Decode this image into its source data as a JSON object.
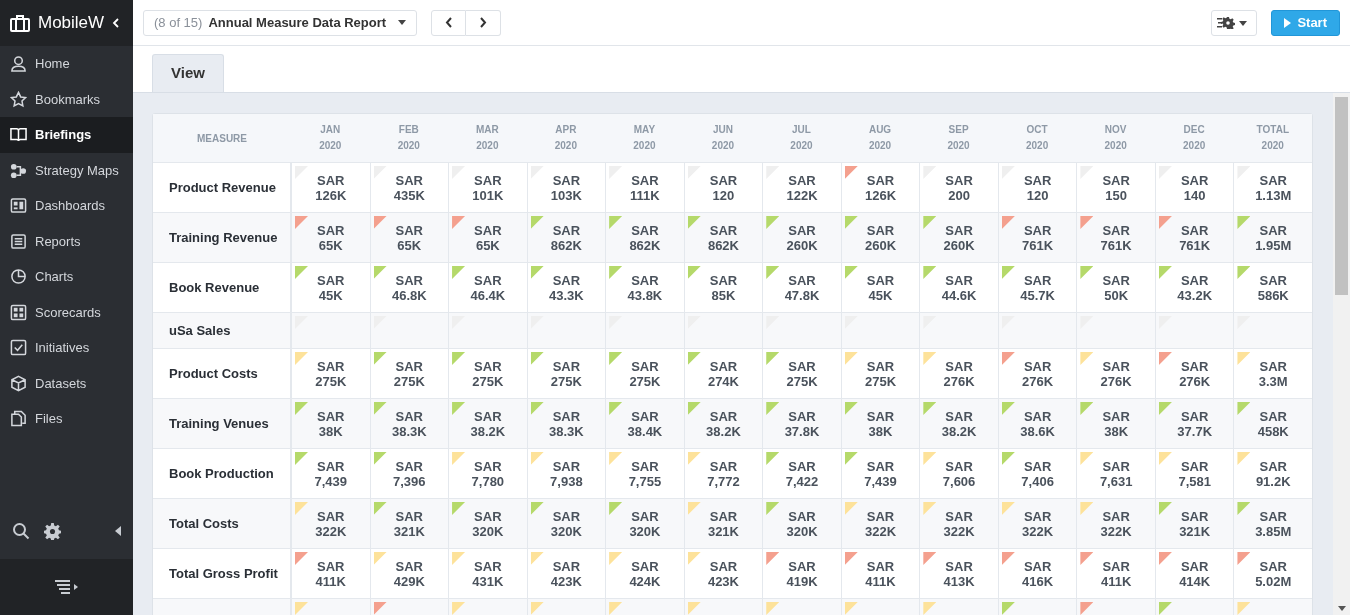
{
  "app": {
    "title": "MobileW"
  },
  "sidebar": {
    "items": [
      {
        "label": "Home",
        "selected": false
      },
      {
        "label": "Bookmarks",
        "selected": false
      },
      {
        "label": "Briefings",
        "selected": true
      },
      {
        "label": "Strategy Maps",
        "selected": false
      },
      {
        "label": "Dashboards",
        "selected": false
      },
      {
        "label": "Reports",
        "selected": false
      },
      {
        "label": "Charts",
        "selected": false
      },
      {
        "label": "Scorecards",
        "selected": false
      },
      {
        "label": "Initiatives",
        "selected": false
      },
      {
        "label": "Datasets",
        "selected": false
      },
      {
        "label": "Files",
        "selected": false
      }
    ]
  },
  "toolbar": {
    "position": "(8 of 15)",
    "report": "Annual Measure Data Report",
    "start": "Start"
  },
  "tabs": [
    {
      "label": "View",
      "selected": true
    }
  ],
  "table": {
    "measure_heading": "MEASURE",
    "columns": [
      {
        "label": "JAN 2020"
      },
      {
        "label": "FEB 2020"
      },
      {
        "label": "MAR 2020"
      },
      {
        "label": "APR 2020"
      },
      {
        "label": "MAY 2020"
      },
      {
        "label": "JUN 2020"
      },
      {
        "label": "JUL 2020"
      },
      {
        "label": "AUG 2020"
      },
      {
        "label": "SEP 2020"
      },
      {
        "label": "OCT 2020"
      },
      {
        "label": "NOV 2020"
      },
      {
        "label": "DEC 2020"
      },
      {
        "label": "TOTAL 2020"
      }
    ],
    "rows": [
      {
        "measure": "Product Revenue",
        "cells": [
          {
            "value": "SAR 126K",
            "color": "#efefef"
          },
          {
            "value": "SAR 435K",
            "color": "#efefef"
          },
          {
            "value": "SAR 101K",
            "color": "#efefef"
          },
          {
            "value": "SAR 103K",
            "color": "#efefef"
          },
          {
            "value": "SAR 111K",
            "color": "#efefef"
          },
          {
            "value": "SAR 120",
            "color": "#efefef"
          },
          {
            "value": "SAR 122K",
            "color": "#efefef"
          },
          {
            "value": "SAR 126K",
            "color": "#f4a08e"
          },
          {
            "value": "SAR 200",
            "color": "#efefef"
          },
          {
            "value": "SAR 120",
            "color": "#efefef"
          },
          {
            "value": "SAR 150",
            "color": "#efefef"
          },
          {
            "value": "SAR 140",
            "color": "#efefef"
          },
          {
            "value": "SAR 1.13M",
            "color": "#efefef"
          }
        ]
      },
      {
        "measure": "Training Revenue",
        "cells": [
          {
            "value": "SAR 65K",
            "color": "#f4a08e"
          },
          {
            "value": "SAR 65K",
            "color": "#f4a08e"
          },
          {
            "value": "SAR 65K",
            "color": "#f4a08e"
          },
          {
            "value": "SAR 862K",
            "color": "#b5d96a"
          },
          {
            "value": "SAR 862K",
            "color": "#b5d96a"
          },
          {
            "value": "SAR 862K",
            "color": "#b5d96a"
          },
          {
            "value": "SAR 260K",
            "color": "#b5d96a"
          },
          {
            "value": "SAR 260K",
            "color": "#b5d96a"
          },
          {
            "value": "SAR 260K",
            "color": "#b5d96a"
          },
          {
            "value": "SAR 761K",
            "color": "#f4a08e"
          },
          {
            "value": "SAR 761K",
            "color": "#f4a08e"
          },
          {
            "value": "SAR 761K",
            "color": "#f4a08e"
          },
          {
            "value": "SAR 1.95M",
            "color": "#b5d96a"
          }
        ]
      },
      {
        "measure": "Book Revenue",
        "cells": [
          {
            "value": "SAR 45K",
            "color": "#b5d96a"
          },
          {
            "value": "SAR 46.8K",
            "color": "#b5d96a"
          },
          {
            "value": "SAR 46.4K",
            "color": "#b5d96a"
          },
          {
            "value": "SAR 43.3K",
            "color": "#b5d96a"
          },
          {
            "value": "SAR 43.8K",
            "color": "#b5d96a"
          },
          {
            "value": "SAR 85K",
            "color": "#b5d96a"
          },
          {
            "value": "SAR 47.8K",
            "color": "#b5d96a"
          },
          {
            "value": "SAR 45K",
            "color": "#b5d96a"
          },
          {
            "value": "SAR 44.6K",
            "color": "#b5d96a"
          },
          {
            "value": "SAR 45.7K",
            "color": "#b5d96a"
          },
          {
            "value": "SAR 50K",
            "color": "#b5d96a"
          },
          {
            "value": "SAR 43.2K",
            "color": "#b5d96a"
          },
          {
            "value": "SAR 586K",
            "color": "#b5d96a"
          }
        ]
      },
      {
        "measure": "uSa Sales",
        "cells": [
          {
            "color": "#efefef"
          },
          {
            "color": "#efefef"
          },
          {
            "color": "#efefef"
          },
          {
            "color": "#efefef"
          },
          {
            "color": "#efefef"
          },
          {
            "color": "#efefef"
          },
          {
            "color": "#efefef"
          },
          {
            "color": "#efefef"
          },
          {
            "color": "#efefef"
          },
          {
            "color": "#efefef"
          },
          {
            "color": "#efefef"
          },
          {
            "color": "#efefef"
          },
          {
            "color": "#efefef"
          }
        ]
      },
      {
        "measure": "Product Costs",
        "cells": [
          {
            "value": "SAR 275K",
            "color": "#fde29a"
          },
          {
            "value": "SAR 275K",
            "color": "#b5d96a"
          },
          {
            "value": "SAR 275K",
            "color": "#b5d96a"
          },
          {
            "value": "SAR 275K",
            "color": "#b5d96a"
          },
          {
            "value": "SAR 275K",
            "color": "#b5d96a"
          },
          {
            "value": "SAR 274K",
            "color": "#b5d96a"
          },
          {
            "value": "SAR 275K",
            "color": "#b5d96a"
          },
          {
            "value": "SAR 275K",
            "color": "#fde29a"
          },
          {
            "value": "SAR 276K",
            "color": "#fde29a"
          },
          {
            "value": "SAR 276K",
            "color": "#f4a08e"
          },
          {
            "value": "SAR 276K",
            "color": "#fde29a"
          },
          {
            "value": "SAR 276K",
            "color": "#f4a08e"
          },
          {
            "value": "SAR 3.3M",
            "color": "#fde29a"
          }
        ]
      },
      {
        "measure": "Training Venues",
        "cells": [
          {
            "value": "SAR 38K",
            "color": "#b5d96a"
          },
          {
            "value": "SAR 38.3K",
            "color": "#b5d96a"
          },
          {
            "value": "SAR 38.2K",
            "color": "#b5d96a"
          },
          {
            "value": "SAR 38.3K",
            "color": "#b5d96a"
          },
          {
            "value": "SAR 38.4K",
            "color": "#b5d96a"
          },
          {
            "value": "SAR 38.2K",
            "color": "#b5d96a"
          },
          {
            "value": "SAR 37.8K",
            "color": "#b5d96a"
          },
          {
            "value": "SAR 38K",
            "color": "#b5d96a"
          },
          {
            "value": "SAR 38.2K",
            "color": "#b5d96a"
          },
          {
            "value": "SAR 38.6K",
            "color": "#b5d96a"
          },
          {
            "value": "SAR 38K",
            "color": "#b5d96a"
          },
          {
            "value": "SAR 37.7K",
            "color": "#b5d96a"
          },
          {
            "value": "SAR 458K",
            "color": "#b5d96a"
          }
        ]
      },
      {
        "measure": "Book Production",
        "cells": [
          {
            "value": "SAR 7,439",
            "color": "#b5d96a"
          },
          {
            "value": "SAR 7,396",
            "color": "#b5d96a"
          },
          {
            "value": "SAR 7,780",
            "color": "#fde29a"
          },
          {
            "value": "SAR 7,938",
            "color": "#fde29a"
          },
          {
            "value": "SAR 7,755",
            "color": "#fde29a"
          },
          {
            "value": "SAR 7,772",
            "color": "#fde29a"
          },
          {
            "value": "SAR 7,422",
            "color": "#b5d96a"
          },
          {
            "value": "SAR 7,439",
            "color": "#b5d96a"
          },
          {
            "value": "SAR 7,606",
            "color": "#fde29a"
          },
          {
            "value": "SAR 7,406",
            "color": "#b5d96a"
          },
          {
            "value": "SAR 7,631",
            "color": "#fde29a"
          },
          {
            "value": "SAR 7,581",
            "color": "#fde29a"
          },
          {
            "value": "SAR 91.2K",
            "color": "#fde29a"
          }
        ]
      },
      {
        "measure": "Total Costs",
        "cells": [
          {
            "value": "SAR 322K",
            "color": "#fde29a"
          },
          {
            "value": "SAR 321K",
            "color": "#b5d96a"
          },
          {
            "value": "SAR 320K",
            "color": "#b5d96a"
          },
          {
            "value": "SAR 320K",
            "color": "#b5d96a"
          },
          {
            "value": "SAR 320K",
            "color": "#b5d96a"
          },
          {
            "value": "SAR 321K",
            "color": "#fde29a"
          },
          {
            "value": "SAR 320K",
            "color": "#b5d96a"
          },
          {
            "value": "SAR 322K",
            "color": "#fde29a"
          },
          {
            "value": "SAR 322K",
            "color": "#fde29a"
          },
          {
            "value": "SAR 322K",
            "color": "#fde29a"
          },
          {
            "value": "SAR 322K",
            "color": "#fde29a"
          },
          {
            "value": "SAR 321K",
            "color": "#b5d96a"
          },
          {
            "value": "SAR 3.85M",
            "color": "#b5d96a"
          }
        ]
      },
      {
        "measure": "Total Gross Profit",
        "cells": [
          {
            "value": "SAR 411K",
            "color": "#f4a08e"
          },
          {
            "value": "SAR 429K",
            "color": "#fde29a"
          },
          {
            "value": "SAR 431K",
            "color": "#fde29a"
          },
          {
            "value": "SAR 423K",
            "color": "#fde29a"
          },
          {
            "value": "SAR 424K",
            "color": "#fde29a"
          },
          {
            "value": "SAR 423K",
            "color": "#fde29a"
          },
          {
            "value": "SAR 419K",
            "color": "#f4a08e"
          },
          {
            "value": "SAR 411K",
            "color": "#f4a08e"
          },
          {
            "value": "SAR 413K",
            "color": "#f4a08e"
          },
          {
            "value": "SAR 416K",
            "color": "#f4a08e"
          },
          {
            "value": "SAR 411K",
            "color": "#f4a08e"
          },
          {
            "value": "SAR 414K",
            "color": "#f4a08e"
          },
          {
            "value": "SAR 5.02M",
            "color": "#f4a08e"
          }
        ]
      },
      {
        "cells": [
          {
            "color": "#fde29a"
          },
          {
            "color": "#f4a08e"
          },
          {
            "color": "#fde29a"
          },
          {
            "color": "#fde29a"
          },
          {
            "color": "#fde29a"
          },
          {
            "color": "#fde29a"
          },
          {
            "color": "#fde29a"
          },
          {
            "color": "#fde29a"
          },
          {
            "color": "#fde29a"
          },
          {
            "color": "#b5d96a"
          },
          {
            "color": "#f4a08e"
          },
          {
            "color": "#b5d96a"
          },
          {
            "color": "#fde29a"
          }
        ]
      }
    ]
  }
}
